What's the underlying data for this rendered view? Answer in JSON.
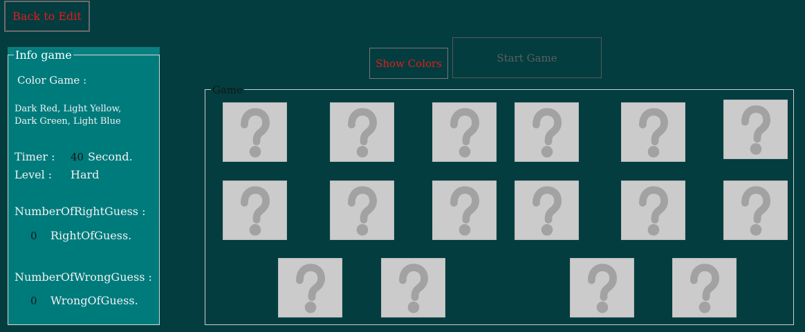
{
  "toolbar": {
    "back_label": "Back to Edit",
    "show_colors_label": "Show Colors",
    "start_game_label": "Start Game"
  },
  "info": {
    "legend": "Info game",
    "color_game_label": "Color Game :",
    "colors_line1": "Dark Red, Light Yellow,",
    "colors_line2": "Dark Green, Light Blue",
    "timer_label": "Timer :",
    "timer_value": "40",
    "timer_unit": "Second.",
    "level_label": "Level :",
    "level_value": "Hard",
    "right_label": "NumberOfRightGuess :",
    "right_value": "0",
    "right_unit": "RightOfGuess.",
    "wrong_label": "NumberOfWrongGuess :",
    "wrong_value": "0",
    "wrong_unit": "WrongOfGuess."
  },
  "game": {
    "legend": "Game",
    "card_count": 16,
    "card_face": "question-mark-icon",
    "card_state": "hidden"
  },
  "colors": {
    "background": "#033d3f",
    "panel": "#007b7c",
    "accent_red": "#e41b1b",
    "card": "#cbcbcb",
    "question_mark": "#a2a2a2"
  }
}
